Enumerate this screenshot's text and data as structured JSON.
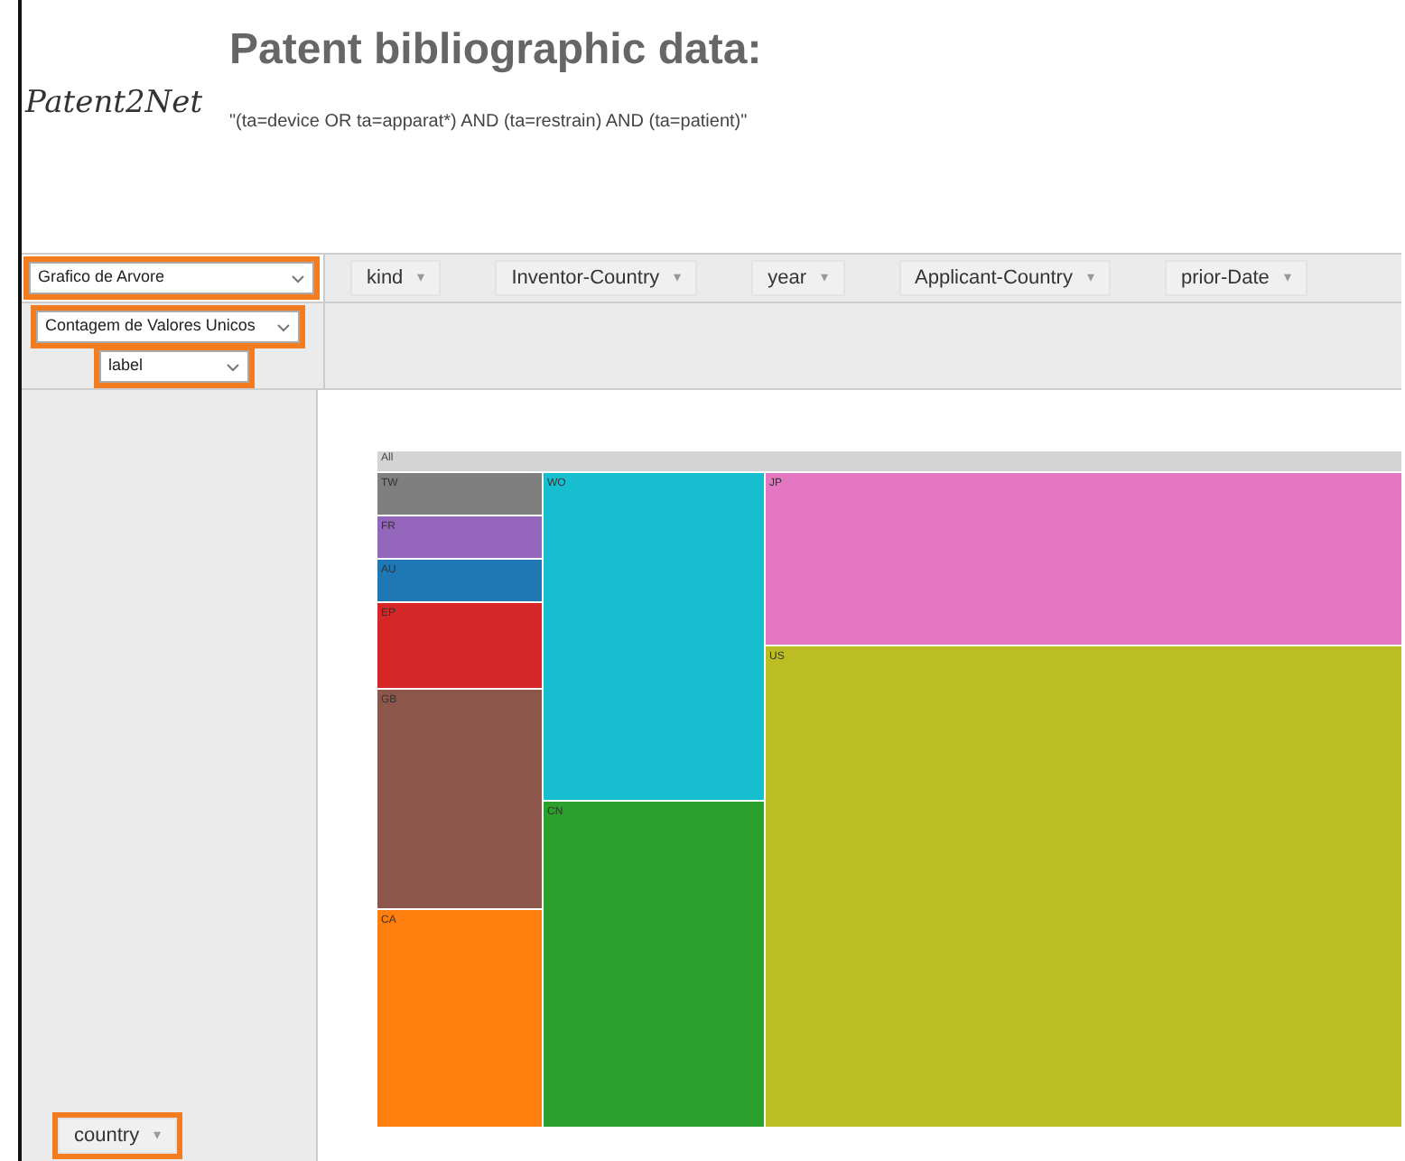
{
  "logo": "Patent2Net",
  "title": "Patent bibliographic data:",
  "query": "\"(ta=device OR ta=apparat*) AND (ta=restrain) AND (ta=patient)\"",
  "renderer_select": {
    "value": "Grafico de Arvore"
  },
  "aggregator_select": {
    "value": "Contagem de Valores Unicos"
  },
  "attribute_select": {
    "value": "label"
  },
  "column_fields": [
    {
      "label": "kind",
      "arrow": "▾"
    },
    {
      "label": "Inventor-Country",
      "arrow": "▾"
    },
    {
      "label": "year",
      "arrow": "▾"
    },
    {
      "label": "Applicant-Country",
      "arrow": "▾"
    },
    {
      "label": "prior-Date",
      "arrow": "▾"
    }
  ],
  "row_fields": [
    {
      "label": "country",
      "arrow": "▾"
    }
  ],
  "treemap": {
    "root": "All",
    "columns": [
      [
        {
          "label": "TW",
          "color": "#7f7f7f"
        },
        {
          "label": "FR",
          "color": "#9467bd"
        },
        {
          "label": "AU",
          "color": "#1f77b4"
        },
        {
          "label": "EP",
          "color": "#d62728"
        },
        {
          "label": "GB",
          "color": "#8c564b"
        },
        {
          "label": "CA",
          "color": "#ff7f0e"
        }
      ],
      [
        {
          "label": "WO",
          "color": "#17becf"
        },
        {
          "label": "CN",
          "color": "#2ca02c"
        }
      ],
      [
        {
          "label": "JP",
          "color": "#e377c2"
        },
        {
          "label": "US",
          "color": "#bcbd22"
        }
      ]
    ]
  }
}
